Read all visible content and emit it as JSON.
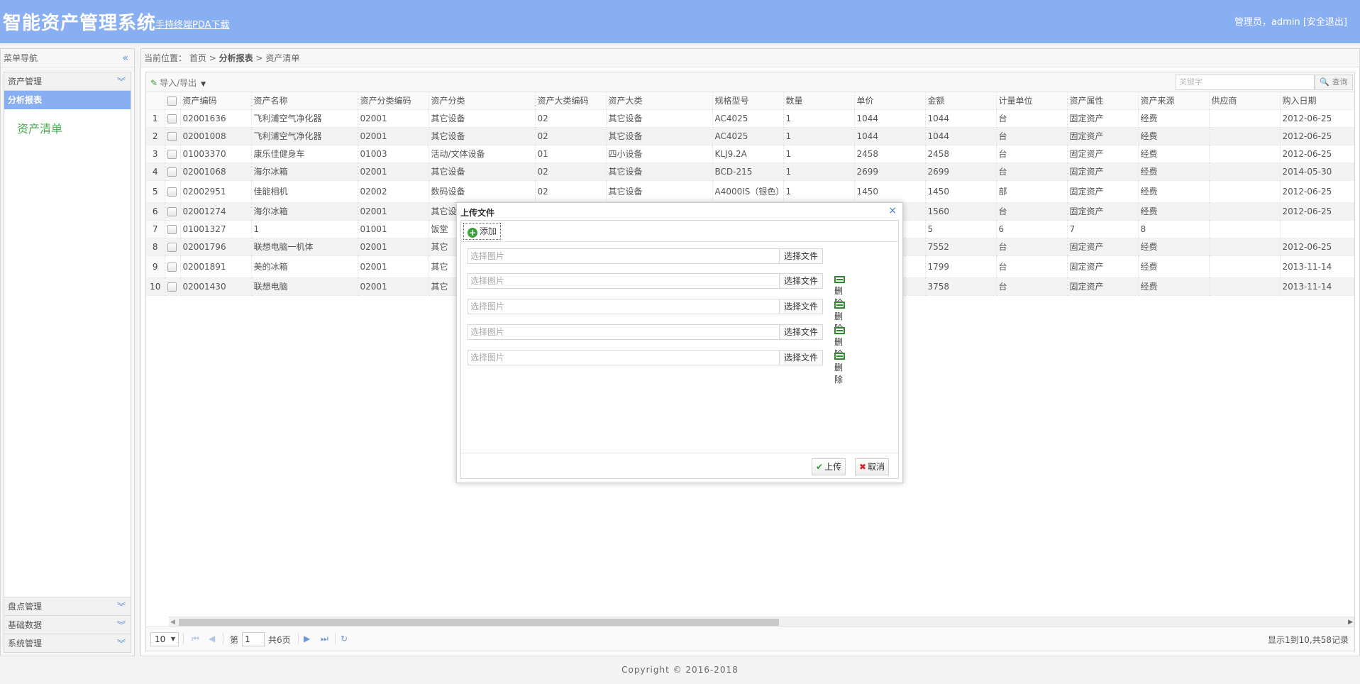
{
  "header": {
    "title": "智能资产管理系统",
    "pda_link": "手持终端PDA下载",
    "user_text": "管理员，admin",
    "logout": "[安全退出]"
  },
  "sidebar": {
    "title": "菜单导航",
    "groups_top": [
      {
        "label": "资产管理"
      }
    ],
    "active_item": "分析报表",
    "leaf_link": "资产清单",
    "groups_bottom": [
      {
        "label": "盘点管理"
      },
      {
        "label": "基础数据"
      },
      {
        "label": "系统管理"
      }
    ]
  },
  "breadcrumb": {
    "prefix": "当前位置：",
    "home": "首页",
    "sep": ">",
    "section": "分析报表",
    "page": "资产清单"
  },
  "toolbar": {
    "import_export": "导入/导出",
    "search_placeholder": "关键字",
    "search_button": "查询"
  },
  "table": {
    "columns": [
      "资产编码",
      "资产名称",
      "资产分类编码",
      "资产分类",
      "资产大类编码",
      "资产大类",
      "规格型号",
      "数量",
      "单价",
      "金额",
      "计量单位",
      "资产属性",
      "资产来源",
      "供应商",
      "购入日期"
    ],
    "rows": [
      {
        "n": "1",
        "cells": [
          "02001636",
          "飞利浦空气净化器",
          "02001",
          "其它设备",
          "02",
          "其它设备",
          "AC4025",
          "1",
          "1044",
          "1044",
          "台",
          "固定资产",
          "经费",
          "",
          "2012-06-25"
        ]
      },
      {
        "n": "2",
        "cells": [
          "02001008",
          "飞利浦空气净化器",
          "02001",
          "其它设备",
          "02",
          "其它设备",
          "AC4025",
          "1",
          "1044",
          "1044",
          "台",
          "固定资产",
          "经费",
          "",
          "2012-06-25"
        ]
      },
      {
        "n": "3",
        "cells": [
          "01003370",
          "康乐佳健身车",
          "01003",
          "活动/文体设备",
          "01",
          "四小设备",
          "KLJ9.2A",
          "1",
          "2458",
          "2458",
          "台",
          "固定资产",
          "经费",
          "",
          "2012-06-25"
        ]
      },
      {
        "n": "4",
        "cells": [
          "02001068",
          "海尔冰箱",
          "02001",
          "其它设备",
          "02",
          "其它设备",
          "BCD-215",
          "1",
          "2699",
          "2699",
          "台",
          "固定资产",
          "经费",
          "",
          "2014-05-30"
        ]
      },
      {
        "n": "5",
        "cells": [
          "02002951",
          "佳能相机",
          "02002",
          "数码设备",
          "02",
          "其它设备",
          "A4000IS（银色）",
          "1",
          "1450",
          "1450",
          "部",
          "固定资产",
          "经费",
          "",
          "2012-06-25"
        ]
      },
      {
        "n": "6",
        "cells": [
          "02001274",
          "海尔冰箱",
          "02001",
          "其它设备",
          "",
          "",
          "",
          "",
          "",
          "1560",
          "台",
          "固定资产",
          "经费",
          "",
          "2012-06-25"
        ]
      },
      {
        "n": "7",
        "cells": [
          "01001327",
          "1",
          "01001",
          "饭堂",
          "",
          "",
          "",
          "",
          "",
          "5",
          "6",
          "7",
          "8",
          "",
          ""
        ]
      },
      {
        "n": "8",
        "cells": [
          "02001796",
          "联想电脑一机体",
          "02001",
          "其它",
          "",
          "",
          "",
          "",
          "",
          "7552",
          "台",
          "固定资产",
          "经费",
          "",
          "2012-06-25"
        ]
      },
      {
        "n": "9",
        "cells": [
          "02001891",
          "美的冰箱",
          "02001",
          "其它",
          "",
          "",
          "",
          "",
          "",
          "1799",
          "台",
          "固定资产",
          "经费",
          "",
          "2013-11-14"
        ]
      },
      {
        "n": "10",
        "cells": [
          "02001430",
          "联想电脑",
          "02001",
          "其它",
          "",
          "",
          "",
          "",
          "",
          "3758",
          "台",
          "固定资产",
          "经费",
          "",
          "2013-11-14"
        ]
      }
    ]
  },
  "pager": {
    "page_size": "10",
    "page_prefix": "第",
    "page_value": "1",
    "page_total": "共6页",
    "info": "显示1到10,共58记录"
  },
  "dialog": {
    "title": "上传文件",
    "add_button": "添加",
    "file_placeholder": "选择图片",
    "choose_button": "选择文件",
    "delete_button": "删 除",
    "upload_button": "上传",
    "cancel_button": "取消"
  },
  "footer": {
    "copyright": "Copyright © 2016-2018"
  },
  "colors": {
    "header_bg": "#89aff3",
    "menu_active": "#89aff3",
    "leaf_link": "#4caf50"
  }
}
